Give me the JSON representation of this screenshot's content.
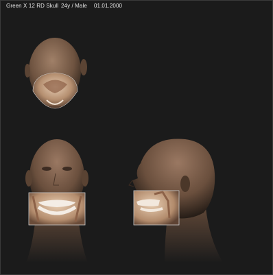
{
  "header": {
    "title": "Green X 12 RD Skull",
    "patient": "24y / Male",
    "date": "01.01.2000"
  },
  "colors": {
    "background": "#1b1b1b",
    "skin": "#8a6a52",
    "bone": "#d9b897"
  },
  "views": [
    {
      "name": "top-view"
    },
    {
      "name": "frontal-view"
    },
    {
      "name": "lateral-view"
    }
  ]
}
